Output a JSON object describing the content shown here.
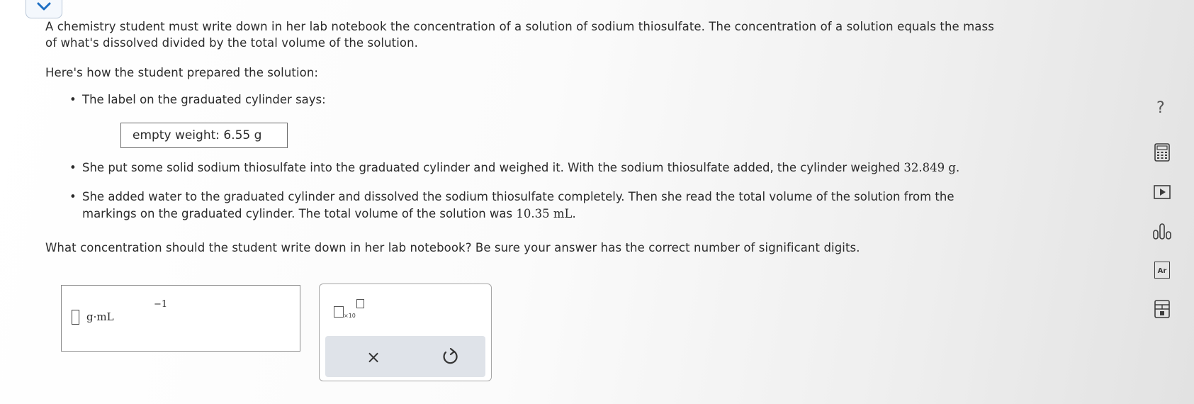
{
  "question": {
    "intro": "A chemistry student must write down in her lab notebook the concentration of a solution of sodium thiosulfate. The concentration of a solution equals the mass of what's dissolved divided by the total volume of the solution.",
    "intro_line1": "A chemistry student must write down in her lab notebook the concentration of a solution of sodium thiosulfate. The concentration of a solution equals the mass",
    "intro_line2": "of what's dissolved divided by the total volume of the solution.",
    "heading": "Here's how the student prepared the solution:",
    "bullet1": "The label on the graduated cylinder says:",
    "label_text": "empty weight: 6.55 g",
    "bullet2_text": "She put some solid sodium thiosulfate into the graduated cylinder and weighed it. With the sodium thiosulfate added, the cylinder weighed ",
    "bullet2_value": "32.849 g",
    "bullet2_end": ".",
    "bullet3_line1": "She added water to the graduated cylinder and dissolved the sodium thiosulfate completely. Then she read the total volume of the solution from the",
    "bullet3_line2_text": "markings on the graduated cylinder. The total volume of the solution was ",
    "bullet3_value": "10.35 mL",
    "bullet3_end": ".",
    "prompt": "What concentration should the student write down in her lab notebook? Be sure your answer has the correct number of significant digits."
  },
  "answer": {
    "unit": "g·mL",
    "unit_exponent": "−1",
    "value": ""
  },
  "tools": {
    "sci_notation_label": "×10",
    "clear_symbol": "×",
    "help_symbol": "?",
    "sidebar_icons": [
      "calculator-icon",
      "video-icon",
      "bar-chart-icon",
      "periodic-table-icon",
      "reference-table-icon"
    ],
    "periodic_label": "Ar"
  },
  "colors": {
    "accent": "#1e6fc4",
    "button_bar": "#dfe3e9"
  }
}
